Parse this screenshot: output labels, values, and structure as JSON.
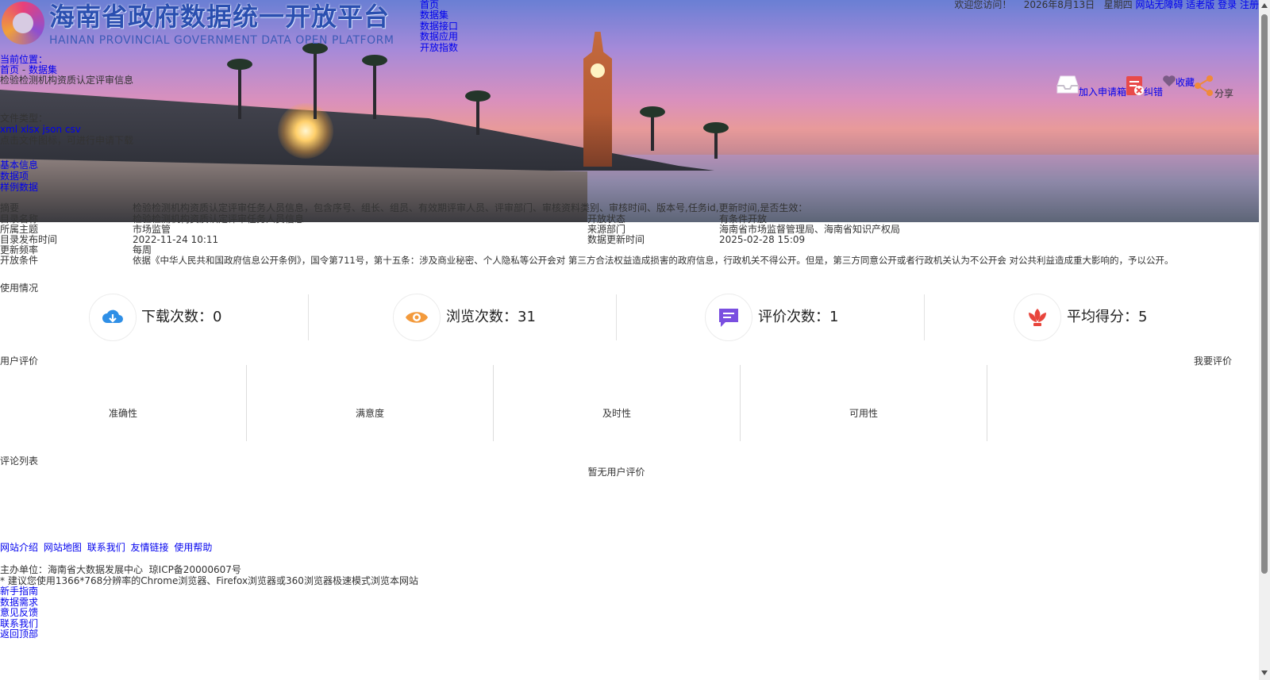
{
  "header": {
    "logo_cn": "海南省政府数据统一开放平台",
    "logo_en": "HAINAN PROVINCIAL GOVERNMENT DATA OPEN PLATFORM",
    "nav": [
      "首页",
      "数据集",
      "数据接口",
      "数据应用",
      "开放指数"
    ],
    "welcome": "欢迎您访问！",
    "date": "2026年8月13日",
    "weekday": "星期四",
    "links": {
      "accessible": "网站无障碍",
      "elder": "适老版",
      "login": "登录",
      "register": "注册"
    }
  },
  "actions": {
    "apply": "加入申请箱",
    "correct": "纠错",
    "favorite": "收藏",
    "share": "分享"
  },
  "banner_overlay": {
    "breadcrumb_home": "首页",
    "breadcrumb_section": "数据集",
    "breadcrumb_prefix": "当前位置：",
    "dataset_title": "检验检测机构资质认定评审信息",
    "file_type_label": "文件类型：",
    "file_types": "xml xlsx json csv",
    "download_hint": "点击文件图标，可进行申请下载",
    "tabs": [
      "基本信息",
      "数据项",
      "样例数据"
    ],
    "desc_label": "摘要",
    "desc_text": "检验检测机构资质认定评审任务人员信息，包含序号、组长、组员、有效期评审人员、评审部门、审核资料类别、审核时间、版本号,任务id,更新时间,是否生效："
  },
  "detail": {
    "rows": [
      {
        "k1": "目录名称",
        "v1": "检验检测机构资质认定评审任务人员信息",
        "k2": "开放状态",
        "v2": "有条件开放"
      },
      {
        "k1": "所属主题",
        "v1": "市场监管",
        "k2": "来源部门",
        "v2": "海南省市场监督管理局、海南省知识产权局"
      },
      {
        "k1": "目录发布时间",
        "v1": "2022-11-24 10:11",
        "k2": "数据更新时间",
        "v2": "2025-02-28 15:09"
      },
      {
        "k1": "更新频率",
        "v1": "每周",
        "k2": "",
        "v2": ""
      },
      {
        "k1": "开放条件",
        "v1": "依据《中华人民共和国政府信息公开条例》，国令第711号，第十五条：涉及商业秘密、个人隐私等公开会对 第三方合法权益造成损害的政府信息，行政机关不得公开。但是，第三方同意公开或者行政机关认为不公开会 对公共利益造成重大影响的，予以公开。",
        "k2": "",
        "v2": ""
      }
    ]
  },
  "usage": {
    "title": "使用情况",
    "stats": [
      {
        "label": "下载次数：0",
        "icon": "cloud-download-icon",
        "color": "#2f8fe6"
      },
      {
        "label": "浏览次数：31",
        "icon": "eye-icon",
        "color": "#f39a3c"
      },
      {
        "label": "评价次数：1",
        "icon": "comment-icon",
        "color": "#7a4fe0"
      },
      {
        "label": "平均得分：5",
        "icon": "lotus-icon",
        "color": "#e8453c"
      }
    ]
  },
  "evaluation": {
    "title": "用户评价",
    "rate_button": "我要评价",
    "criteria": [
      "准确性",
      "满意度",
      "及时性",
      "可用性"
    ],
    "comments_title": "评论列表",
    "empty_text": "暂无用户评价"
  },
  "footer": {
    "links": [
      "网站介绍",
      "网站地图",
      "联系我们",
      "友情链接",
      "使用帮助"
    ],
    "host": "主办单位：海南省大数据发展中心",
    "icp": "琼ICP备20000607号",
    "tip": "* 建议您使用1366*768分辨率的Chrome浏览器、Firefox浏览器或360浏览器极速模式浏览本网站",
    "side_links": [
      "新手指南",
      "数据需求",
      "意见反馈",
      "联系我们",
      "返回顶部"
    ]
  }
}
